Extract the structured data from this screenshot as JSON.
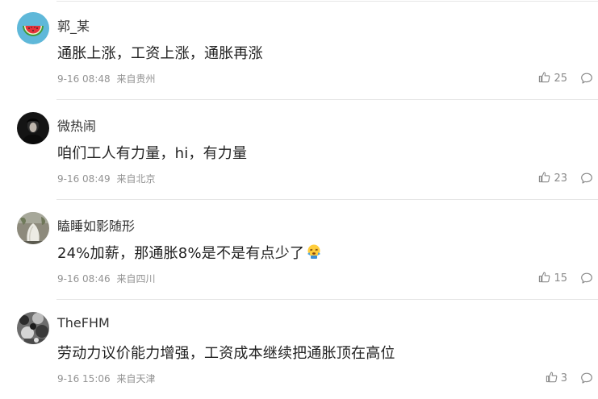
{
  "comments": [
    {
      "username": "郭_某",
      "text": "通胀上涨，工资上涨，通胀再涨",
      "time": "9-16 08:48",
      "location": "来自贵州",
      "likes": "25",
      "avatar_icon": "watermelon-avatar"
    },
    {
      "username": "微热闹",
      "text": "咱们工人有力量，hi，有力量",
      "time": "9-16 08:49",
      "location": "来自北京",
      "likes": "23",
      "avatar_icon": "dark-portrait-avatar"
    },
    {
      "username": "瞌睡如影随形",
      "text": "24%加薪，那通胀8%是不是有点少了",
      "time": "9-16 08:46",
      "location": "来自四川",
      "likes": "15",
      "avatar_icon": "plant-photo-avatar"
    },
    {
      "username": "TheFHM",
      "text": "劳动力议价能力增强，工资成本继续把通胀顶在高位",
      "time": "9-16 15:06",
      "location": "来自天津",
      "likes": "3",
      "avatar_icon": "grayscale-photo-avatar"
    }
  ]
}
